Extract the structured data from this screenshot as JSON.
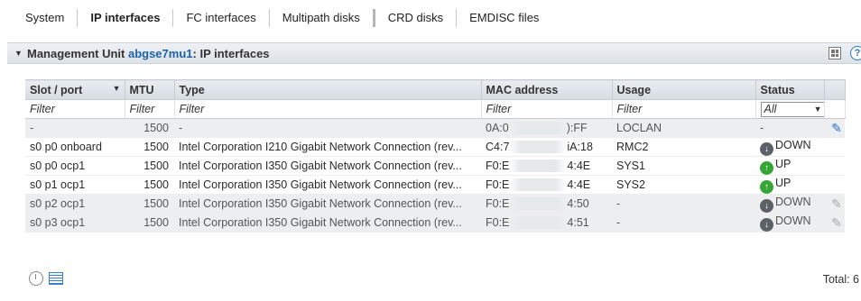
{
  "tabs": [
    {
      "label": "System"
    },
    {
      "label": "IP interfaces"
    },
    {
      "label": "FC interfaces"
    },
    {
      "label": "Multipath disks"
    },
    {
      "label": "CRD disks"
    },
    {
      "label": "EMDISC files"
    }
  ],
  "active_tab": "IP interfaces",
  "panel": {
    "title_prefix": "Management Unit ",
    "unit_link": "abgse7mu1",
    "title_suffix": ":  IP interfaces",
    "help_glyph": "?"
  },
  "table": {
    "columns": [
      "Slot / port",
      "MTU",
      "Type",
      "MAC address",
      "Usage",
      "Status",
      ""
    ],
    "filter_placeholder": "Filter",
    "status_filter_value": "All",
    "rows": [
      {
        "slot": "-",
        "mtu": "1500",
        "type": "-",
        "mac_start": "0A:0",
        "mac_end": "):FF",
        "usage": "LOCLAN",
        "status": "-",
        "status_kind": "none",
        "edit": "blue",
        "gray": true
      },
      {
        "slot": "s0 p0 onboard",
        "mtu": "1500",
        "type": "Intel Corporation I210 Gigabit Network Connection (rev...",
        "mac_start": "C4:7",
        "mac_end": "iA:18",
        "usage": "RMC2",
        "status": "DOWN",
        "status_kind": "down",
        "edit": "none",
        "gray": false
      },
      {
        "slot": "s0 p0 ocp1",
        "mtu": "1500",
        "type": "Intel Corporation I350 Gigabit Network Connection (rev...",
        "mac_start": "F0:E",
        "mac_end": "4:4E",
        "usage": "SYS1",
        "status": "UP",
        "status_kind": "up",
        "edit": "none",
        "gray": false
      },
      {
        "slot": "s0 p1 ocp1",
        "mtu": "1500",
        "type": "Intel Corporation I350 Gigabit Network Connection (rev...",
        "mac_start": "F0:E",
        "mac_end": "4:4E",
        "usage": "SYS2",
        "status": "UP",
        "status_kind": "up",
        "edit": "none",
        "gray": false
      },
      {
        "slot": "s0 p2 ocp1",
        "mtu": "1500",
        "type": "Intel Corporation I350 Gigabit Network Connection (rev...",
        "mac_start": "F0:E",
        "mac_end": "4:50",
        "usage": "-",
        "status": "DOWN",
        "status_kind": "down",
        "edit": "gray",
        "gray": true
      },
      {
        "slot": "s0 p3 ocp1",
        "mtu": "1500",
        "type": "Intel Corporation I350 Gigabit Network Connection (rev...",
        "mac_start": "F0:E",
        "mac_end": "4:51",
        "usage": "-",
        "status": "DOWN",
        "status_kind": "down",
        "edit": "gray",
        "gray": true
      }
    ]
  },
  "footer": {
    "total_label": "Total: 6",
    "icons": [
      "refresh-clock-icon",
      "export-table-icon"
    ]
  },
  "colors": {
    "link": "#1d63a8",
    "status_up": "#35a635",
    "status_down": "#5c6167",
    "edit_active": "#2a6fc4"
  }
}
